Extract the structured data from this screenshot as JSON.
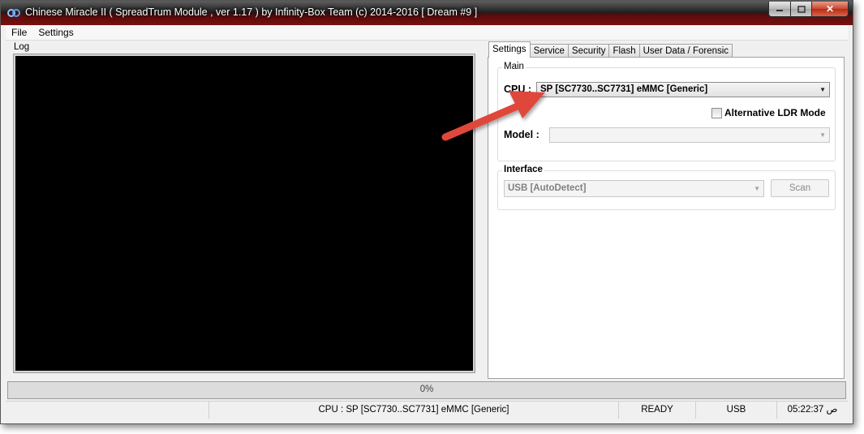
{
  "window": {
    "title": "Chinese Miracle II ( SpreadTrum Module , ver 1.17 ) by Infinity-Box Team (c) 2014-2016 [ Dream #9 ]",
    "icon": "infinity-icon"
  },
  "caption_buttons": {
    "minimize_icon": "minimize-icon",
    "maximize_icon": "maximize-icon",
    "close_glyph": "✕"
  },
  "menu": {
    "items": [
      "File",
      "Settings"
    ]
  },
  "log": {
    "label": "Log"
  },
  "tabs": [
    "Settings",
    "Service",
    "Security",
    "Flash",
    "User Data / Forensic"
  ],
  "settings": {
    "main_group": {
      "title": "Main",
      "cpu_label": "CPU :",
      "cpu_value": "SP [SC7730..SC7731] eMMC [Generic]",
      "alt_ldr_label": "Alternative LDR Mode",
      "alt_ldr_checked": false,
      "model_label": "Model :",
      "model_value": ""
    },
    "interface_group": {
      "title": "Interface",
      "interface_value": "USB [AutoDetect]",
      "scan_label": "Scan"
    }
  },
  "progress": {
    "text": "0%",
    "value": 0
  },
  "statusbar": {
    "cpu": "CPU : SP [SC7730..SC7731] eMMC [Generic]",
    "state": "READY",
    "connection": "USB",
    "time": "05:22:37 ص"
  },
  "colors": {
    "annotation_arrow": "#e0463a",
    "log_background": "#000000"
  }
}
